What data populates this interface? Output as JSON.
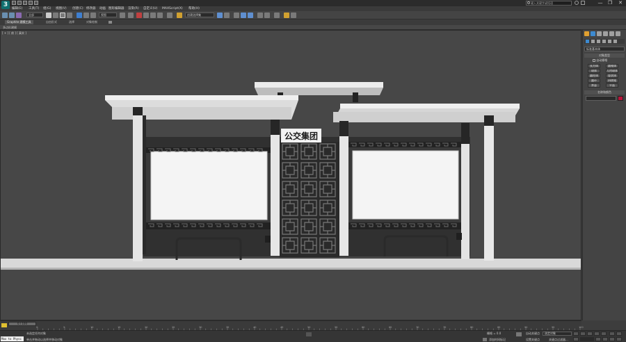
{
  "app": {
    "logo_text": "3",
    "search_placeholder": "键入关键字或短语",
    "window_controls": [
      "—",
      "❐",
      "✕"
    ]
  },
  "quick_access": {
    "selection_filter": "全部",
    "viewport_dropdown": "视图",
    "selection_set_placeholder": "创建选择集"
  },
  "menu": {
    "items": [
      "编辑(E)",
      "工具(T)",
      "组(G)",
      "视图(V)",
      "创建(C)",
      "修改器",
      "动画",
      "图形编辑器",
      "渲染(R)",
      "自定义(U)",
      "MAXScript(X)",
      "帮助(H)"
    ]
  },
  "ribbon": {
    "tabs": [
      "Graphite 建模工具",
      "自由形式",
      "选择",
      "对象绘制"
    ],
    "active_tab": "Graphite 建模工具",
    "sub_label": "多边形建模"
  },
  "viewport": {
    "label": "[ + ] [ 前 ] [ 真实 ]",
    "sign_text": "公交集团",
    "colors": {
      "background": "#474747",
      "ground": "#dcdcdc",
      "roof": "#ededed",
      "pillar_light": "#e8e8e8",
      "pillar_dark": "#2b2b2b",
      "panel": "#f4f4f4",
      "lattice": "#2a2a2a"
    }
  },
  "command_panel": {
    "category_dropdown": "标准基本体",
    "rollout_object_type": "对象类型",
    "autogrid_label": "自动栅格",
    "buttons": [
      "长方体",
      "圆锥体",
      "球体",
      "几何球体",
      "圆柱体",
      "管状体",
      "圆环",
      "四棱锥",
      "茶壶",
      "平面"
    ],
    "rollout_name_color": "名称和颜色",
    "color_swatch": "#b8143a"
  },
  "timeline": {
    "frame_slider": "0 / 100",
    "ticks": [
      "0",
      "5",
      "10",
      "15",
      "20",
      "25",
      "30",
      "35",
      "40",
      "45",
      "50",
      "55",
      "60",
      "65",
      "70",
      "75",
      "80",
      "85",
      "90",
      "95",
      "100"
    ]
  },
  "status": {
    "maxscript": "Max to Physc",
    "line1": "未选定任何对象",
    "line2": "单击并拖动以选择并移动对象",
    "grid_label": "栅格 = 0.0",
    "add_time_tag": "添加时间标记",
    "auto_key": "自动关键点",
    "selected_object": "选定对象",
    "set_key": "设置关键点",
    "key_filters": "关键点过滤器..."
  }
}
